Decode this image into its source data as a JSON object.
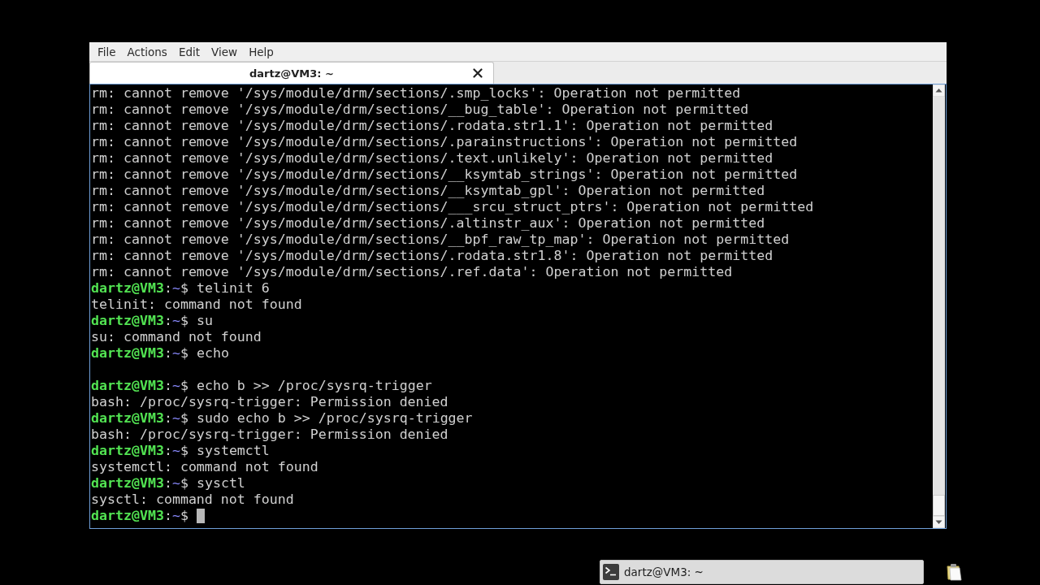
{
  "menu_bar": {
    "items": [
      "File",
      "Actions",
      "Edit",
      "View",
      "Help"
    ]
  },
  "tabs": [
    {
      "title": "dartz@VM3: ~",
      "selected": true
    }
  ],
  "terminal": {
    "lines": [
      {
        "kind": "output",
        "text": "rm: cannot remove '/sys/module/drm/sections/.smp_locks': Operation not permitted"
      },
      {
        "kind": "output",
        "text": "rm: cannot remove '/sys/module/drm/sections/__bug_table': Operation not permitted"
      },
      {
        "kind": "output",
        "text": "rm: cannot remove '/sys/module/drm/sections/.rodata.str1.1': Operation not permitted"
      },
      {
        "kind": "output",
        "text": "rm: cannot remove '/sys/module/drm/sections/.parainstructions': Operation not permitted"
      },
      {
        "kind": "output",
        "text": "rm: cannot remove '/sys/module/drm/sections/.text.unlikely': Operation not permitted"
      },
      {
        "kind": "output",
        "text": "rm: cannot remove '/sys/module/drm/sections/__ksymtab_strings': Operation not permitted"
      },
      {
        "kind": "output",
        "text": "rm: cannot remove '/sys/module/drm/sections/__ksymtab_gpl': Operation not permitted"
      },
      {
        "kind": "output",
        "text": "rm: cannot remove '/sys/module/drm/sections/___srcu_struct_ptrs': Operation not permitted"
      },
      {
        "kind": "output",
        "text": "rm: cannot remove '/sys/module/drm/sections/.altinstr_aux': Operation not permitted"
      },
      {
        "kind": "output",
        "text": "rm: cannot remove '/sys/module/drm/sections/__bpf_raw_tp_map': Operation not permitted"
      },
      {
        "kind": "output",
        "text": "rm: cannot remove '/sys/module/drm/sections/.rodata.str1.8': Operation not permitted"
      },
      {
        "kind": "output",
        "text": "rm: cannot remove '/sys/module/drm/sections/.ref.data': Operation not permitted"
      },
      {
        "kind": "prompt",
        "user_host": "dartz@VM3",
        "sep": ":",
        "path": "~",
        "sign": "$",
        "command": "telinit 6",
        "cursor": false
      },
      {
        "kind": "output",
        "text": "telinit: command not found"
      },
      {
        "kind": "prompt",
        "user_host": "dartz@VM3",
        "sep": ":",
        "path": "~",
        "sign": "$",
        "command": "su",
        "cursor": false
      },
      {
        "kind": "output",
        "text": "su: command not found"
      },
      {
        "kind": "prompt",
        "user_host": "dartz@VM3",
        "sep": ":",
        "path": "~",
        "sign": "$",
        "command": "echo",
        "cursor": false
      },
      {
        "kind": "blank"
      },
      {
        "kind": "prompt",
        "user_host": "dartz@VM3",
        "sep": ":",
        "path": "~",
        "sign": "$",
        "command": "echo b >> /proc/sysrq-trigger",
        "cursor": false
      },
      {
        "kind": "output",
        "text": "bash: /proc/sysrq-trigger: Permission denied"
      },
      {
        "kind": "prompt",
        "user_host": "dartz@VM3",
        "sep": ":",
        "path": "~",
        "sign": "$",
        "command": "sudo echo b >> /proc/sysrq-trigger",
        "cursor": false
      },
      {
        "kind": "output",
        "text": "bash: /proc/sysrq-trigger: Permission denied"
      },
      {
        "kind": "prompt",
        "user_host": "dartz@VM3",
        "sep": ":",
        "path": "~",
        "sign": "$",
        "command": "systemctl",
        "cursor": false
      },
      {
        "kind": "output",
        "text": "systemctl: command not found"
      },
      {
        "kind": "prompt",
        "user_host": "dartz@VM3",
        "sep": ":",
        "path": "~",
        "sign": "$",
        "command": "sysctl",
        "cursor": false
      },
      {
        "kind": "output",
        "text": "sysctl: command not found"
      },
      {
        "kind": "prompt",
        "user_host": "dartz@VM3",
        "sep": ":",
        "path": "~",
        "sign": "$",
        "cursor": true
      }
    ]
  },
  "taskbar": {
    "tasks": [
      {
        "title": "dartz@VM3: ~"
      }
    ]
  }
}
